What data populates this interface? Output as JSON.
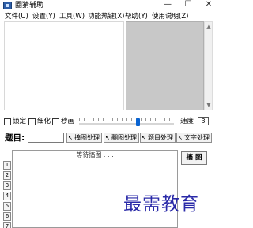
{
  "window": {
    "title": "圈猜辅助",
    "minimize_glyph": "—",
    "maximize_glyph": "☐",
    "close_glyph": "✕"
  },
  "menu": {
    "items": [
      {
        "label": "文件(U)"
      },
      {
        "label": "设置(Y)"
      },
      {
        "label": "工具(W)"
      },
      {
        "label": "功能热键(X)"
      },
      {
        "label": "帮助(Y)"
      },
      {
        "label": "使用说明(Z)"
      }
    ]
  },
  "options": {
    "lock_label": "锁定",
    "lock_checked": false,
    "refine_label": "细化",
    "refine_checked": false,
    "seconds_label": "秒画",
    "seconds_checked": false,
    "slider_level": 0.62,
    "speed_label": "速度",
    "speed_value": "3"
  },
  "question": {
    "label": "题目:",
    "input_value": "",
    "buttons": [
      {
        "label": "搐图处理"
      },
      {
        "label": "翻图处理"
      },
      {
        "label": "题目处理"
      },
      {
        "label": "文字处理"
      }
    ]
  },
  "canvas": {
    "waiting_text": "等待搐图 . . .",
    "row_numbers": [
      "1",
      "2",
      "3",
      "4",
      "5",
      "6",
      "7"
    ]
  },
  "capture_button": {
    "label": "搐 图"
  },
  "watermark": {
    "text": "最需教育"
  },
  "colors": {
    "slider_thumb": "#0a64d2",
    "picture_box": "#c8c8c8",
    "watermark": "#2a2aa8"
  },
  "icons": {
    "app": "app-icon",
    "tool_cursor": "cursor-arrow-icon"
  }
}
